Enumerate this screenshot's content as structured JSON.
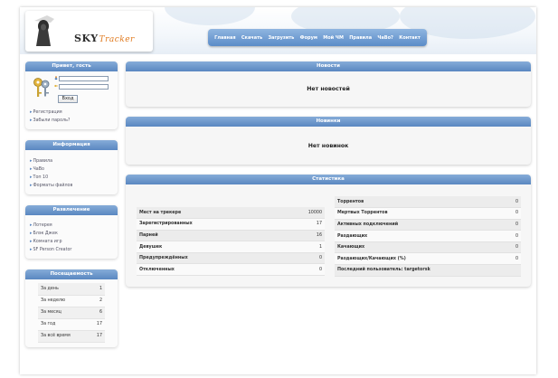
{
  "header": {
    "logo_main": "SKY",
    "logo_accent": "Tracker",
    "nav": [
      "Главная",
      "Скачать",
      "Загрузить",
      "Форум",
      "Мой ЧМ",
      "Правила",
      "ЧаВо?",
      "Контакт"
    ]
  },
  "sidebar": {
    "login": {
      "title": "Привет, гость",
      "button": "Вход",
      "links": [
        "Регистрация",
        "Забыли пароль?"
      ]
    },
    "info": {
      "title": "Информация",
      "links": [
        "Правила",
        "ЧаВо",
        "Топ 10",
        "Форматы файлов"
      ]
    },
    "fun": {
      "title": "Развлечение",
      "links": [
        "Лотерея",
        "Блэк Джек",
        "Комната игр",
        "SF Person Creator"
      ]
    },
    "visits": {
      "title": "Посещаемость",
      "rows": [
        {
          "label": "За день",
          "value": "1"
        },
        {
          "label": "За неделю",
          "value": "2"
        },
        {
          "label": "За месяц",
          "value": "6"
        },
        {
          "label": "За год",
          "value": "17"
        },
        {
          "label": "За всё время",
          "value": "17"
        }
      ]
    }
  },
  "main": {
    "news": {
      "title": "Новости",
      "message": "Нет новостей"
    },
    "novelties": {
      "title": "Новинки",
      "message": "Нет новинок"
    },
    "stats": {
      "title": "Статистика",
      "left": [
        {
          "label": "Мест на трекере",
          "value": "10000"
        },
        {
          "label": "Зарегистрированных",
          "value": "17"
        },
        {
          "label": "Парней",
          "value": "16"
        },
        {
          "label": "Девушек",
          "value": "1"
        },
        {
          "label": "Предупреждённых",
          "value": "0"
        },
        {
          "label": "Отключенных",
          "value": "0"
        }
      ],
      "right": [
        {
          "label": "Торрентов",
          "value": "0"
        },
        {
          "label": "Мертвых Торрентов",
          "value": "0"
        },
        {
          "label": "Активных подключений",
          "value": "0"
        },
        {
          "label": "Раздающих",
          "value": "0"
        },
        {
          "label": "Качающих",
          "value": "0"
        },
        {
          "label": "Раздающих/Качающих (%)",
          "value": "0"
        },
        {
          "label": "Последний пользователь: targetorsk",
          "value": ""
        }
      ]
    }
  },
  "colors": {
    "accent": "#5a87c1",
    "logo_accent": "#e07a1f"
  }
}
